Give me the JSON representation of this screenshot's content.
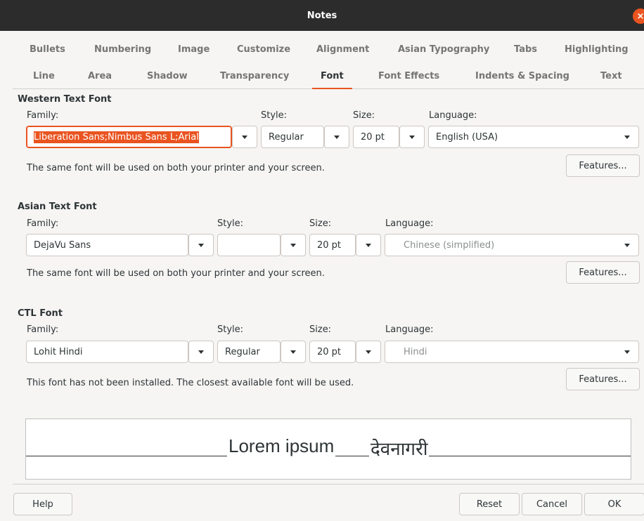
{
  "window": {
    "title": "Notes",
    "close_glyph": "×"
  },
  "tabs_row1": [
    "Bullets",
    "Numbering",
    "Image",
    "Customize",
    "Alignment",
    "Asian Typography",
    "Tabs",
    "Highlighting"
  ],
  "tabs_row2": [
    "Line",
    "Area",
    "Shadow",
    "Transparency",
    "Font",
    "Font Effects",
    "Indents & Spacing",
    "Text"
  ],
  "active_tab": "Font",
  "labels": {
    "family": "Family:",
    "style": "Style:",
    "size": "Size:",
    "language": "Language:",
    "features": "Features..."
  },
  "western": {
    "title": "Western Text Font",
    "family": "Liberation Sans;Nimbus Sans L;Arial",
    "style": "Regular",
    "size": "20 pt",
    "language": "English (USA)",
    "note": "The same font will be used on both your printer and your screen."
  },
  "asian": {
    "title": "Asian Text Font",
    "family": "DejaVu Sans",
    "style": "",
    "size": "20 pt",
    "language": "Chinese (simplified)",
    "note": "The same font will be used on both your printer and your screen."
  },
  "ctl": {
    "title": "CTL Font",
    "family": "Lohit Hindi",
    "style": "Regular",
    "size": "20 pt",
    "language": "Hindi",
    "note": "This font has not been installed. The closest available font will be used."
  },
  "preview": {
    "latin": "Lorem ipsum",
    "devanagari": "देवनागरी"
  },
  "buttons": {
    "help": "Help",
    "reset": "Reset",
    "cancel": "Cancel",
    "ok": "OK"
  },
  "colors": {
    "accent": "#e95420",
    "titlebar": "#2c2c2c"
  },
  "icons": {
    "close": "close-icon",
    "dropdown": "chevron-down-icon"
  }
}
